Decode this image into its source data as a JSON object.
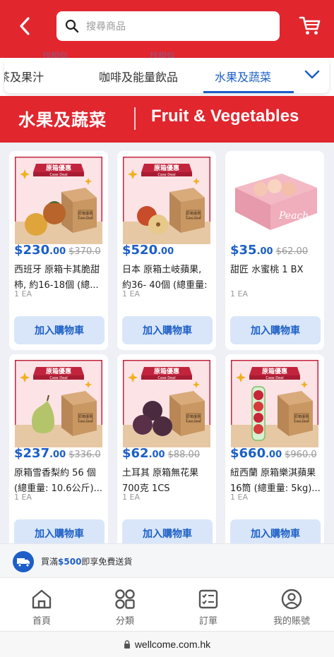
{
  "search": {
    "placeholder": "搜尋商品"
  },
  "ghost_tabs": [
    "找相似",
    "找相似"
  ],
  "category_tabs": [
    "茶及果汁",
    "咖啡及能量飲品",
    "水果及蔬菜"
  ],
  "active_tab": "水果及蔬菜",
  "banner": {
    "zh": "水果及蔬菜",
    "en": "Fruit & Vegetables"
  },
  "product_badge": {
    "zh": "原箱優惠",
    "en": "Case Deal",
    "box_text": "原箱優惠\nCase Deal"
  },
  "products": [
    {
      "price_dollar": "$230",
      "price_cents": ".00",
      "price_old": "$370.0",
      "name": "西班牙 原箱卡其脆甜柿, 約16-18個 (總...",
      "unit": "1 EA",
      "button": "加入購物車",
      "image": "persimmon-case-deal"
    },
    {
      "price_dollar": "$520",
      "price_cents": ".00",
      "price_old": "",
      "name": "日本 原箱土岐蘋果, 約36- 40個 (總重量: ...",
      "unit": "1 EA",
      "button": "加入購物車",
      "image": "apple-case-deal"
    },
    {
      "price_dollar": "$35",
      "price_cents": ".00",
      "price_old": "$62.00",
      "name": "甜匠 水蜜桃 1 BX",
      "unit": "1 EA",
      "button": "加入購物車",
      "image": "peach-box",
      "box_label": "Peach"
    },
    {
      "price_dollar": "$237",
      "price_cents": ".00",
      "price_old": "$336.0",
      "name": "原箱雪香梨約 56 個 (總重量: 10.6公斤)...",
      "unit": "1 EA",
      "button": "加入購物車",
      "image": "pear-case-deal"
    },
    {
      "price_dollar": "$62",
      "price_cents": ".00",
      "price_old": "$88.00",
      "name": "土耳其 原箱無花果 700克 1CS",
      "unit": "1 EA",
      "button": "加入購物車",
      "image": "fig-case-deal"
    },
    {
      "price_dollar": "$660",
      "price_cents": ".00",
      "price_old": "$960.0",
      "name": "紐西蘭 原箱樂淇蘋果16筒 (總重量: 5kg)...",
      "unit": "1 EA",
      "button": "加入購物車",
      "image": "rockit-apple-case-deal"
    }
  ],
  "promo": {
    "prefix": "買滿",
    "amount": "$500",
    "suffix": "即享免費送貨"
  },
  "nav": [
    {
      "label": "首頁",
      "icon": "home-icon"
    },
    {
      "label": "分類",
      "icon": "category-icon"
    },
    {
      "label": "訂單",
      "icon": "orders-icon"
    },
    {
      "label": "我的賬號",
      "icon": "account-icon"
    }
  ],
  "url": "wellcome.com.hk",
  "colors": {
    "brand_red": "#e1262e",
    "accent_blue": "#1c5fc7",
    "button_bg": "#d9e6fa"
  }
}
